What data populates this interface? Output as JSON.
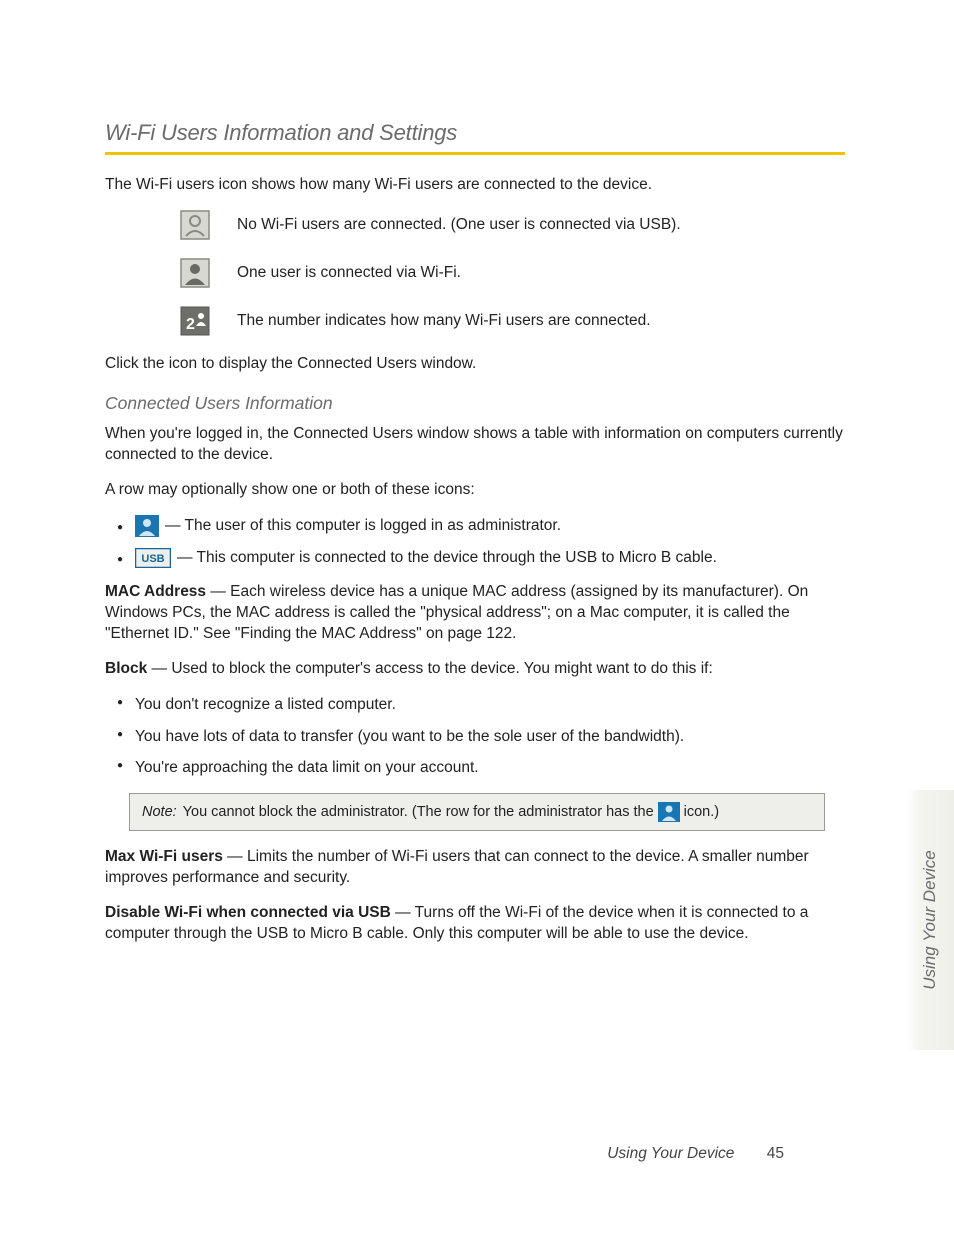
{
  "heading": "Wi-Fi Users Information and Settings",
  "intro": "The Wi-Fi users icon shows how many Wi-Fi users are connected to the device.",
  "iconRows": {
    "r0": "No Wi-Fi users are connected. (One user is connected via USB).",
    "r1": "One user is connected via Wi-Fi.",
    "r2": "The number indicates how many Wi-Fi users are connected."
  },
  "click_prompt": "Click the icon to display the Connected Users window.",
  "subhead": "Connected Users Information",
  "sub_p1": "When you're logged in, the Connected Users window shows a table with information on computers currently connected to the device.",
  "sub_p2": "A row may optionally show one or both of these icons:",
  "iconBullets": {
    "b0": "— The user of this computer is logged in as administrator.",
    "b1": "— This computer is connected to the device through the USB to Micro B cable."
  },
  "mac_lead": "MAC Address",
  "mac_body": " — Each wireless device has a unique MAC address (assigned by its manufacturer). On Windows PCs, the MAC address is called the \"physical address\"; on a Mac computer, it is called the \"Ethernet ID.\" See \"Finding the MAC Address\" on page 122.",
  "block_lead": "Block",
  "block_body": " — Used to block the computer's access to the device. You might want to do this if:",
  "block_list": {
    "i0": "You don't recognize a listed computer.",
    "i1": "You have lots of data to transfer (you want to be the sole user of the bandwidth).",
    "i2": "You're approaching the data limit on your account."
  },
  "note_label": "Note:",
  "note_text_a": "You cannot block the administrator. (The row for the administrator has the",
  "note_text_b": "icon.)",
  "max_lead": "Max Wi-Fi users",
  "max_body": " — Limits the number of Wi-Fi users that can connect to the device. A smaller number improves performance and security.",
  "disable_lead": "Disable Wi-Fi when connected via USB",
  "disable_body": " — Turns off the Wi-Fi of the device when it is connected to a computer through the USB to Micro B cable. Only this computer will be able to use the device.",
  "side_tab": "Using Your Device",
  "footer_chapter": "Using Your Device",
  "footer_page": "45"
}
